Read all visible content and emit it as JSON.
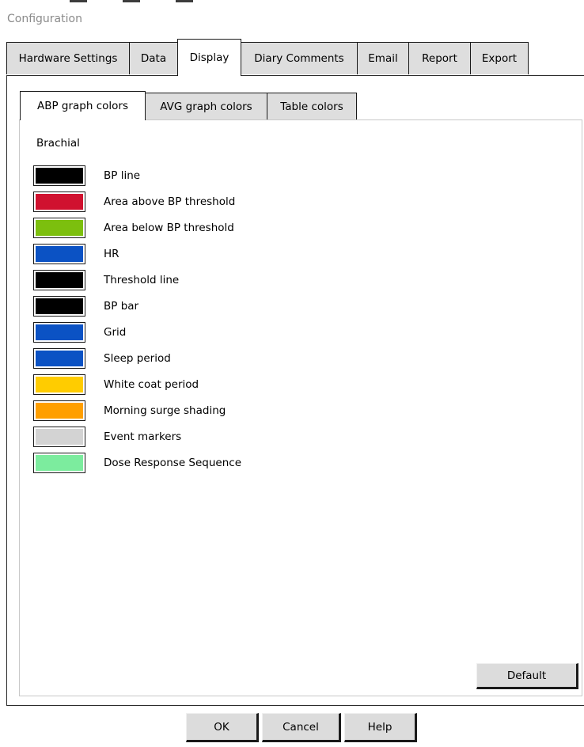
{
  "window": {
    "title": "Configuration"
  },
  "outer_tabs": [
    {
      "label": "Hardware Settings"
    },
    {
      "label": "Data"
    },
    {
      "label": "Display"
    },
    {
      "label": "Diary Comments"
    },
    {
      "label": "Email"
    },
    {
      "label": "Report"
    },
    {
      "label": "Export"
    }
  ],
  "inner_tabs": [
    {
      "label": "ABP graph colors"
    },
    {
      "label": "AVG graph colors"
    },
    {
      "label": "Table colors"
    }
  ],
  "section": {
    "label": "Brachial"
  },
  "color_items": [
    {
      "label": "BP line",
      "color": "#000000"
    },
    {
      "label": "Area above BP threshold",
      "color": "#d0112f"
    },
    {
      "label": "Area below BP threshold",
      "color": "#7cbf0e"
    },
    {
      "label": "HR",
      "color": "#0b52c4"
    },
    {
      "label": "Threshold line",
      "color": "#000000"
    },
    {
      "label": "BP bar",
      "color": "#000000"
    },
    {
      "label": "Grid",
      "color": "#0b52c4"
    },
    {
      "label": "Sleep period",
      "color": "#0b52c4"
    },
    {
      "label": "White coat period",
      "color": "#ffcc00"
    },
    {
      "label": "Morning surge shading",
      "color": "#ff9f00"
    },
    {
      "label": "Event markers",
      "color": "#d3d3d3"
    },
    {
      "label": "Dose Response Sequence",
      "color": "#7cec9e"
    }
  ],
  "buttons": {
    "default_label": "Default",
    "ok_label": "OK",
    "cancel_label": "Cancel",
    "help_label": "Help"
  }
}
